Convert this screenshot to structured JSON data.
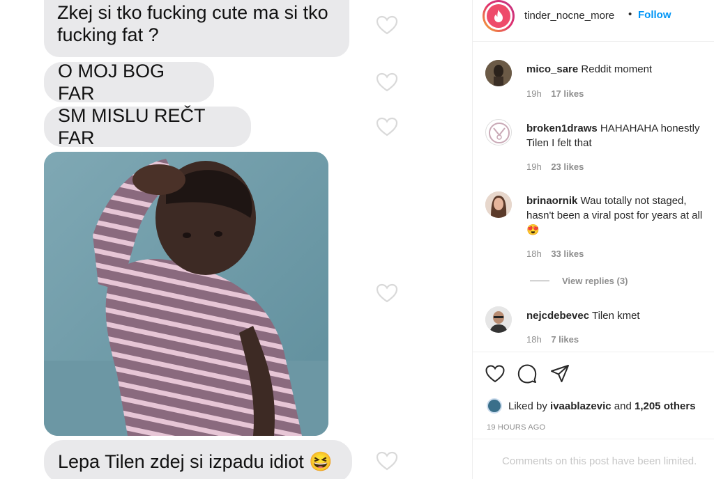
{
  "chat": {
    "message1_line1": "Zkej si tko fucking cute ma si tko",
    "message1_line2": "fucking fat ?",
    "message2": "O MOJ BOG FAR",
    "message3": "SM MISLU REČT FAR",
    "message4": "Lepa Tilen zdej si izpadu idiot 😆"
  },
  "header": {
    "username": "tinder_nocne_more",
    "separator": "•",
    "follow_label": "Follow"
  },
  "comments": [
    {
      "username": "mico_sare",
      "text": "Reddit moment",
      "time": "19h",
      "likes": "17 likes"
    },
    {
      "username": "broken1draws",
      "text": "HAHAHAHA honestly Tilen I felt that",
      "time": "19h",
      "likes": "23 likes"
    },
    {
      "username": "brinaornik",
      "text": "Wau totally not staged, hasn't been a viral post for years at all 😍",
      "time": "18h",
      "likes": "33 likes"
    },
    {
      "username": "nejcdebevec",
      "text": "Tilen kmet",
      "time": "18h",
      "likes": "7 likes"
    }
  ],
  "view_replies": "View replies (3)",
  "likes_info": {
    "prefix": "Liked by",
    "user": "ivaablazevic",
    "conjunction": "and",
    "others": "1,205 others"
  },
  "timestamp": "19 HOURS AGO",
  "comments_limited": "Comments on this post have been limited.",
  "icons": {
    "like": "heart-icon",
    "comment": "comment-bubble-icon",
    "share": "paper-plane-icon"
  },
  "colors": {
    "accent": "#0095f6",
    "bubble": "#e9e9eb",
    "muted": "#8e8e8e"
  }
}
